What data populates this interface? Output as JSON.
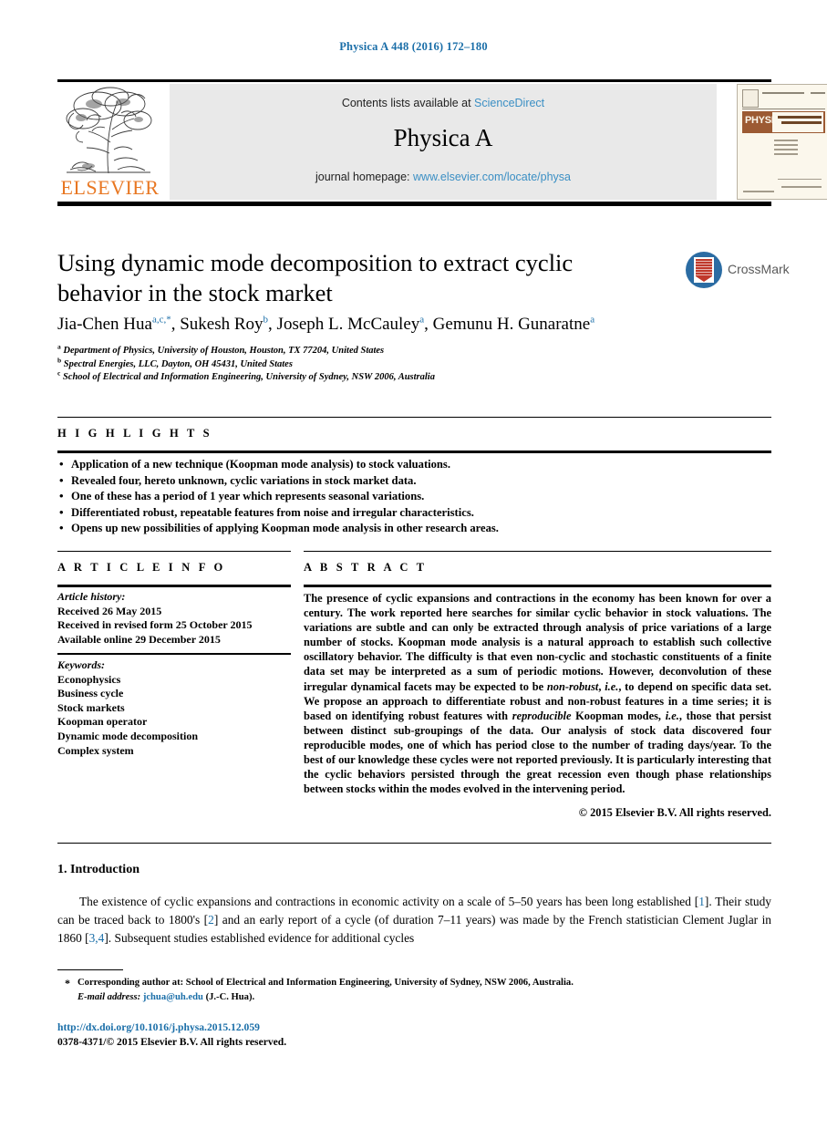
{
  "running_head": "Physica A 448 (2016) 172–180",
  "masthead": {
    "contents_prefix": "Contents lists available at ",
    "sciencedirect": "ScienceDirect",
    "journal_title": "Physica A",
    "homepage_prefix": "journal homepage: ",
    "homepage_url": "www.elsevier.com/locate/physa",
    "publisher_wordmark": "ELSEVIER",
    "cover_band_title": "PHYSICA",
    "link_color": "#3b8fc4",
    "publisher_color": "#E87722",
    "cover_band_color": "#9c5a33"
  },
  "article": {
    "title": "Using dynamic mode decomposition to extract cyclic behavior in the stock market",
    "authors": [
      {
        "name": "Jia-Chen Hua",
        "sup": "a,c,*"
      },
      {
        "name": "Sukesh Roy",
        "sup": "b"
      },
      {
        "name": "Joseph L. McCauley",
        "sup": "a"
      },
      {
        "name": "Gemunu H. Gunaratne",
        "sup": "a"
      }
    ],
    "affiliations": [
      {
        "marker": "a",
        "text": "Department of Physics, University of Houston, Houston, TX 77204, United States"
      },
      {
        "marker": "b",
        "text": "Spectral Energies, LLC, Dayton, OH 45431, United States"
      },
      {
        "marker": "c",
        "text": "School of Electrical and Information Engineering, University of Sydney, NSW 2006, Australia"
      }
    ],
    "crossmark_label": "CrossMark"
  },
  "highlights": {
    "heading": "H I G H L I G H T S",
    "items": [
      "Application of a new technique (Koopman mode analysis) to stock valuations.",
      "Revealed four, hereto unknown, cyclic variations in stock market data.",
      "One of these has a period of 1 year which represents seasonal variations.",
      "Differentiated robust, repeatable features from noise and irregular characteristics.",
      "Opens up new possibilities of applying Koopman mode analysis in other research areas."
    ]
  },
  "article_info": {
    "heading": "A R T I C L E    I N F O",
    "history_label": "Article history:",
    "history": [
      "Received 26 May 2015",
      "Received in revised form 25 October 2015",
      "Available online 29 December 2015"
    ],
    "keywords_label": "Keywords:",
    "keywords": [
      "Econophysics",
      "Business cycle",
      "Stock markets",
      "Koopman operator",
      "Dynamic mode decomposition",
      "Complex system"
    ]
  },
  "abstract": {
    "heading": "A B S T R A C T",
    "p1": "The presence of cyclic expansions and contractions in the economy has been known for over a century. The work reported here searches for similar cyclic behavior in stock valuations. The variations are subtle and can only be extracted through analysis of price variations of a large number of stocks. Koopman mode analysis is a natural approach to establish such collective oscillatory behavior. The difficulty is that even non-cyclic and stochastic constituents of a finite data set may be interpreted as a sum of periodic motions. However, deconvolution of these irregular dynamical facets may be expected to be ",
    "em1": "non-robust",
    "p2": ", ",
    "em2": "i.e.",
    "p3": ", to depend on specific data set. We propose an approach to differentiate robust and non-robust features in a time series; it is based on identifying robust features with ",
    "em3": "reproducible",
    "p4": " Koopman modes, ",
    "em4": "i.e.",
    "p5": ", those that persist between distinct sub-groupings of the data. Our analysis of stock data discovered four reproducible modes, one of which has period close to the number of trading days/year. To the best of our knowledge these cycles were not reported previously. It is particularly interesting that the cyclic behaviors persisted through the great recession even though phase relationships between stocks within the modes evolved in the intervening period.",
    "copyright": "© 2015 Elsevier B.V. All rights reserved."
  },
  "introduction": {
    "heading": "1.  Introduction",
    "t1": "The existence of cyclic expansions and contractions in economic activity on a scale of 5–50 years has been long established [",
    "c1": "1",
    "t2": "]. Their study can be traced back to 1800's [",
    "c2": "2",
    "t3": "] and an early report of a cycle (of duration 7–11 years) was made by the French statistician Clement Juglar in 1860 [",
    "c3": "3,4",
    "t4": "]. Subsequent studies established evidence for additional cycles"
  },
  "footer": {
    "star": "*",
    "corresponding": "Corresponding author at: School of Electrical and Information Engineering, University of Sydney, NSW 2006, Australia.",
    "email_label": "E-mail address:",
    "email": "jchua@uh.edu",
    "email_suffix": "(J.-C. Hua).",
    "doi": "http://dx.doi.org/10.1016/j.physa.2015.12.059",
    "issn_line": "0378-4371/© 2015 Elsevier B.V. All rights reserved.",
    "link_color": "#1a6ea8"
  }
}
